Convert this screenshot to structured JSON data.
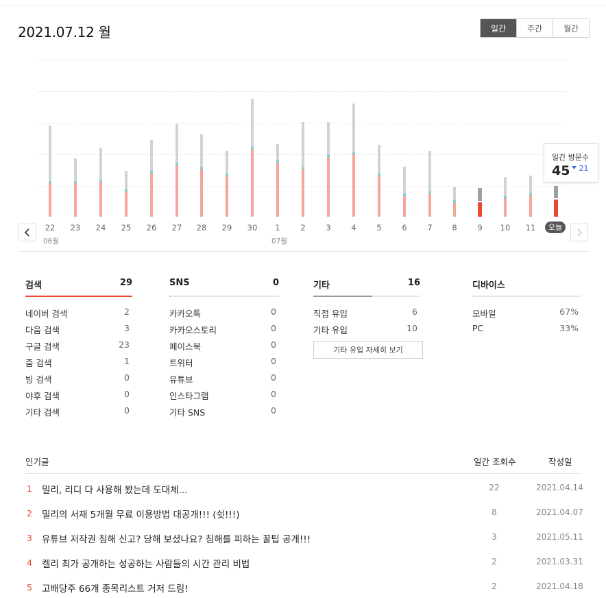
{
  "header": {
    "date_title": "2021.07.12 월",
    "period_tabs": [
      {
        "label": "일간",
        "active": true
      },
      {
        "label": "주간",
        "active": false
      },
      {
        "label": "월간",
        "active": false
      }
    ]
  },
  "chart": {
    "colors": {
      "primary": "#f7a59b",
      "secondary": "#cfd3d6",
      "accent": "#6fd6cf",
      "highlight": "#e84b35",
      "highlight_secondary": "#9aa1a6"
    },
    "months": [
      "06월",
      "07월"
    ],
    "today_label": "오늘",
    "tooltip": {
      "label": "일간 방문수",
      "value": "45",
      "change": "21",
      "change_direction": "down"
    },
    "icons": {
      "prev": "chevron-left-icon",
      "next": "chevron-right-icon",
      "change": "triangle-down-icon"
    }
  },
  "chart_data": {
    "type": "bar",
    "categories": [
      "22",
      "23",
      "24",
      "25",
      "26",
      "27",
      "28",
      "29",
      "30",
      "1",
      "2",
      "3",
      "4",
      "5",
      "6",
      "7",
      "8",
      "9",
      "10",
      "11",
      "오늘"
    ],
    "series": [
      {
        "values": [
          33,
          33,
          34,
          25,
          43,
          50,
          46,
          40,
          66,
          53,
          46,
          58,
          61,
          40,
          20,
          23,
          14,
          14,
          18,
          21,
          17
        ]
      },
      {
        "values": [
          54,
          22,
          31,
          18,
          30,
          38,
          32,
          22,
          47,
          16,
          44,
          32,
          47,
          28,
          27,
          39,
          13,
          13,
          19,
          17,
          12
        ]
      }
    ],
    "highlighted": [
      "9",
      "오늘"
    ]
  },
  "stats": {
    "search": {
      "title": "검색",
      "total": "29",
      "fill_ratio": 1.0,
      "color": "#e84b35",
      "rows": [
        {
          "name": "네이버 검색",
          "value": "2"
        },
        {
          "name": "다음 검색",
          "value": "3"
        },
        {
          "name": "구글 검색",
          "value": "23"
        },
        {
          "name": "줌 검색",
          "value": "1"
        },
        {
          "name": "빙 검색",
          "value": "0"
        },
        {
          "name": "야후 검색",
          "value": "0"
        },
        {
          "name": "기타 검색",
          "value": "0"
        }
      ]
    },
    "sns": {
      "title": "SNS",
      "total": "0",
      "fill_ratio": 0.01,
      "color": "#6fd6cf",
      "rows": [
        {
          "name": "카카오톡",
          "value": "0"
        },
        {
          "name": "카카오스토리",
          "value": "0"
        },
        {
          "name": "페이스북",
          "value": "0"
        },
        {
          "name": "트위터",
          "value": "0"
        },
        {
          "name": "유튜브",
          "value": "0"
        },
        {
          "name": "인스타그램",
          "value": "0"
        },
        {
          "name": "기타 SNS",
          "value": "0"
        }
      ]
    },
    "etc": {
      "title": "기타",
      "total": "16",
      "fill_ratio": 0.55,
      "color": "#999999",
      "rows": [
        {
          "name": "직접 유입",
          "value": "6"
        },
        {
          "name": "기타 유입",
          "value": "10"
        }
      ],
      "detail_button": "기타 유입 자세히 보기"
    },
    "device": {
      "title": "디바이스",
      "rows": [
        {
          "name": "모바일",
          "value": "67%"
        },
        {
          "name": "PC",
          "value": "33%"
        }
      ]
    }
  },
  "popular": {
    "header": {
      "title": "인기글",
      "views": "일간 조회수",
      "date": "작성일"
    },
    "rows": [
      {
        "rank": "1",
        "title": "밀리, 리디 다 사용해 봤는데 도대체...",
        "views": "22",
        "date": "2021.04.14"
      },
      {
        "rank": "2",
        "title": "밀리의 서재 5개월 무료 이용방법 대공개!!! (쉿!!!)",
        "views": "8",
        "date": "2021.04.07"
      },
      {
        "rank": "3",
        "title": "유튜브 저작권 침해 신고? 당해 보셨나요? 침해를 피하는 꿀팁 공개!!!",
        "views": "3",
        "date": "2021.05.11"
      },
      {
        "rank": "4",
        "title": "켈리 최가 공개하는 성공하는 사람들의 시간 관리 비법",
        "views": "2",
        "date": "2021.03.31"
      },
      {
        "rank": "5",
        "title": "고배당주 66개 종목리스트 거저 드림!",
        "views": "2",
        "date": "2021.04.18"
      }
    ]
  }
}
